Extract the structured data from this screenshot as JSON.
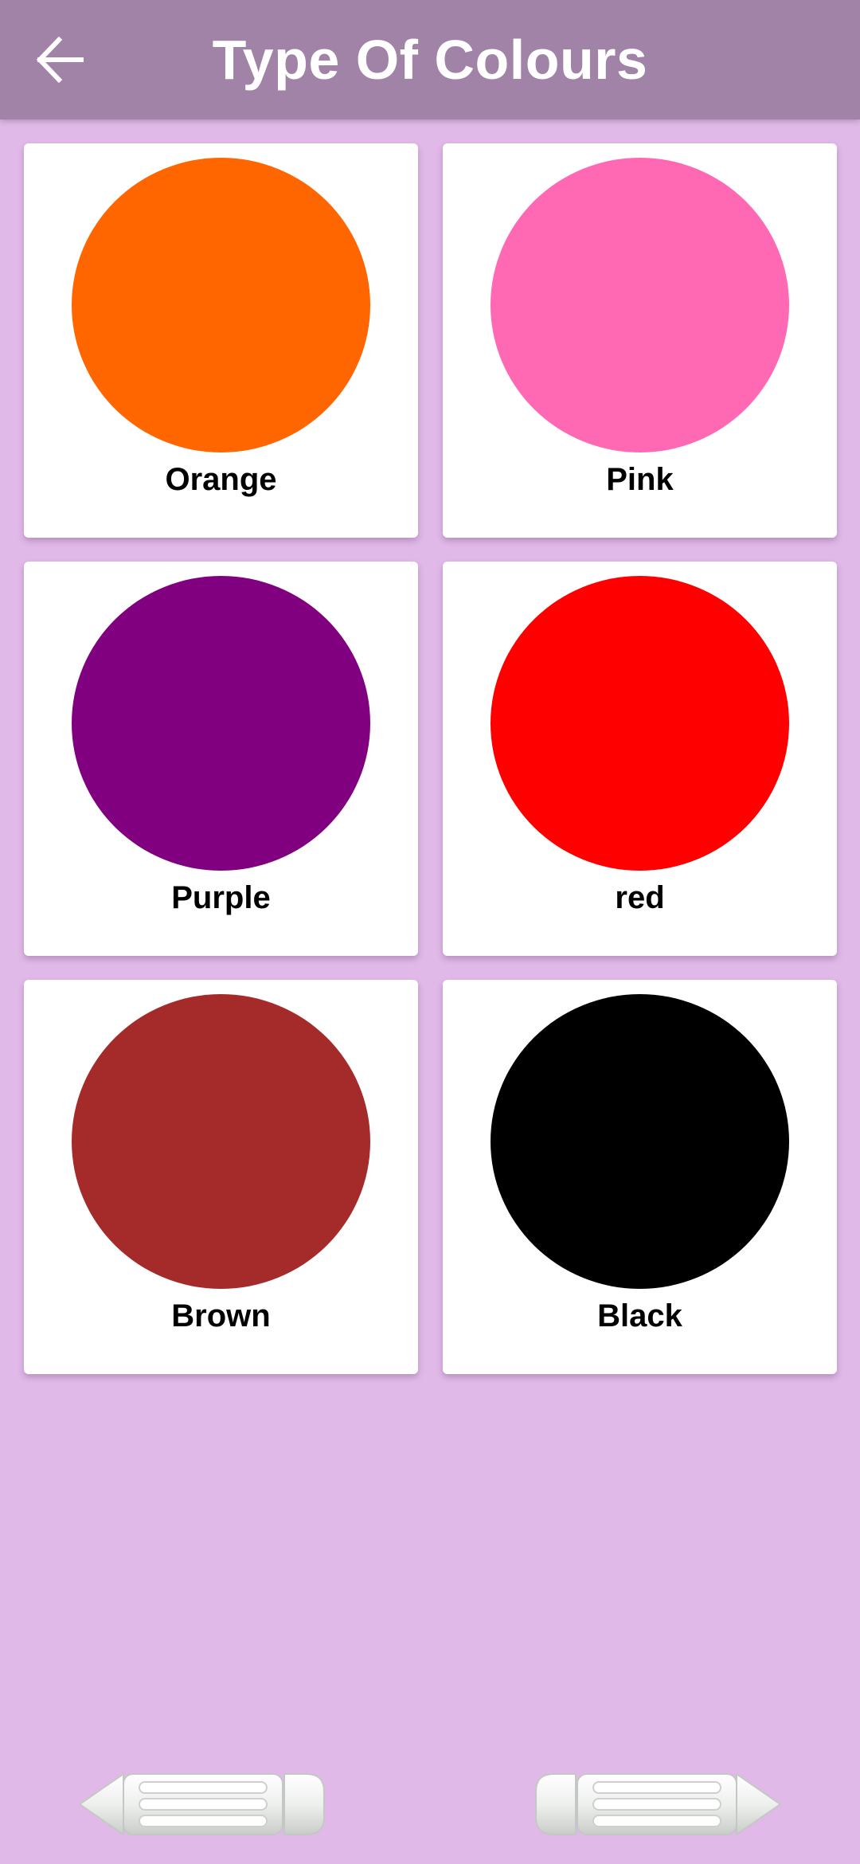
{
  "app_bar": {
    "title": "Type Of Colours",
    "back_icon": "arrow-left-icon",
    "background": "#a083a7"
  },
  "background": "#e1b9e8",
  "colors": [
    {
      "label": "Orange",
      "hex": "#ff6600"
    },
    {
      "label": "Pink",
      "hex": "#ff69b4"
    },
    {
      "label": "Purple",
      "hex": "#800080"
    },
    {
      "label": "red",
      "hex": "#ff0000"
    },
    {
      "label": "Brown",
      "hex": "#a52a2a"
    },
    {
      "label": "Black",
      "hex": "#000000"
    }
  ],
  "nav": {
    "prev_icon": "pencil-left-arrow-icon",
    "next_icon": "pencil-right-arrow-icon"
  }
}
